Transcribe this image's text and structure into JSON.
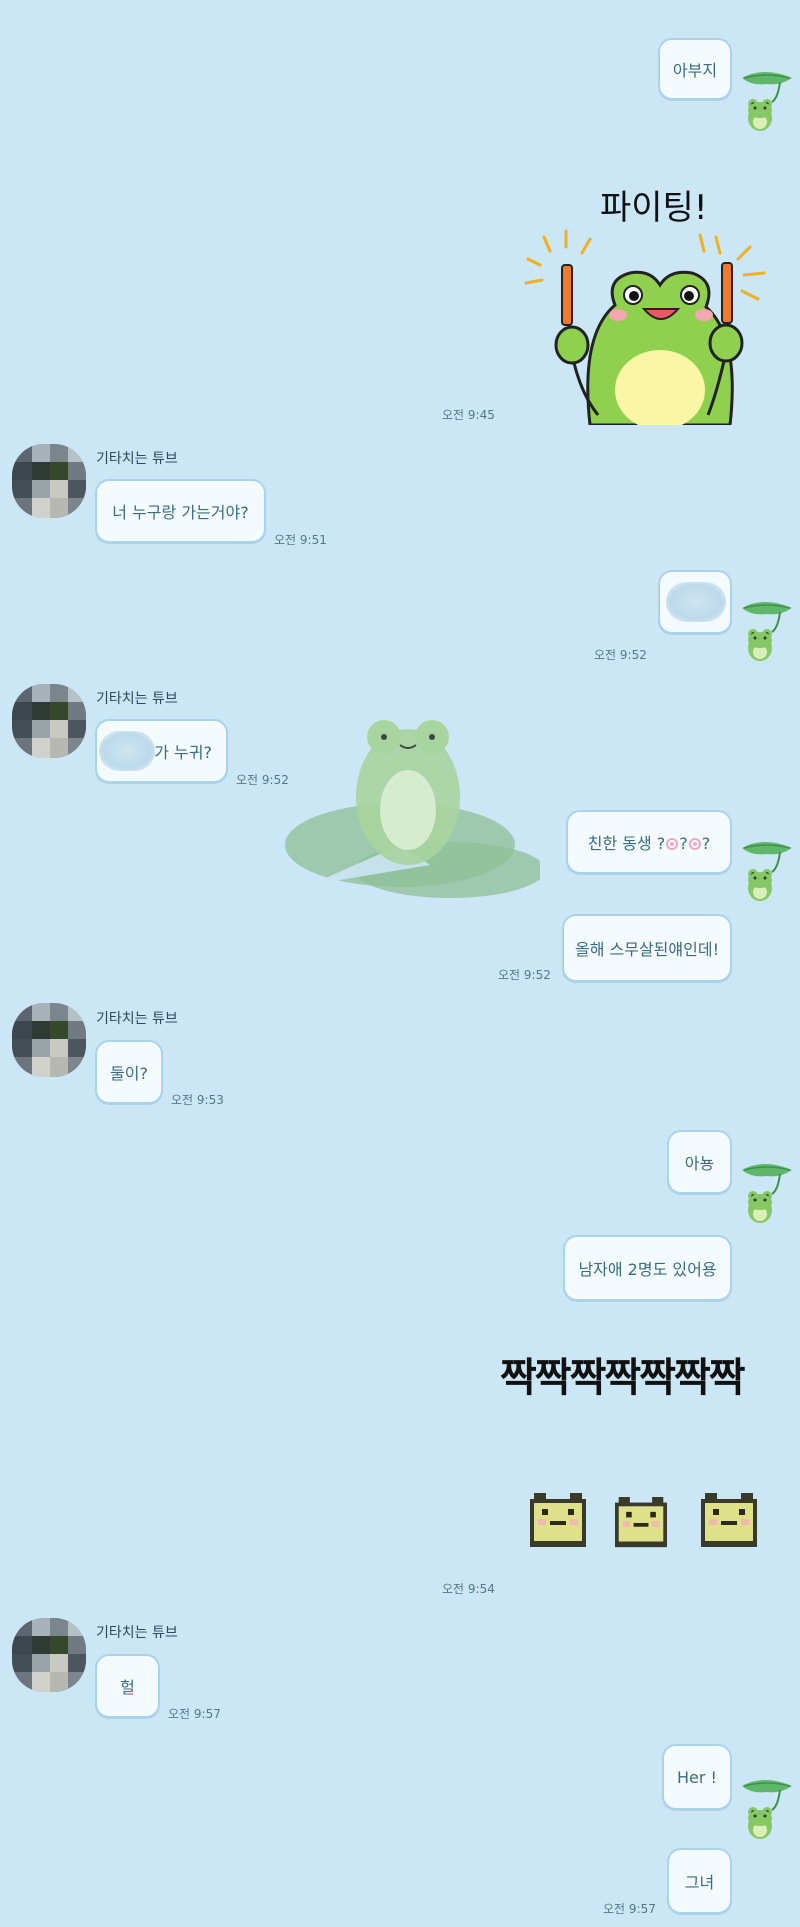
{
  "contact": {
    "name": "기타치는 튜브"
  },
  "messages": {
    "m1": "아부지",
    "sticker1_text": "파이팅!",
    "t1": "오전 9:45",
    "m2": "너 누구랑 가는거야?",
    "t2": "오전 9:51",
    "t3": "오전 9:52",
    "m3_suffix": "가 누귀?",
    "t4": "오전 9:52",
    "m4_prefix": "친한 동생 ?",
    "m4_mid": "?",
    "m4_end": "?",
    "m5": "올해 스무살된얘인데!",
    "t5": "오전 9:52",
    "m6": "둘이?",
    "t6": "오전 9:53",
    "m7": "아뇽",
    "m8": "남자애 2명도 있어용",
    "sticker2_text": "짝짝짝짝짝짝짝",
    "t7": "오전 9:54",
    "m9": "헐",
    "t8": "오전 9:57",
    "m10": "Her !",
    "m11": "그녀",
    "t9": "오전 9:57"
  },
  "colors": {
    "background": "#cbe6f5",
    "bubble": "#f3fbff",
    "bubble_border": "#a9d3e8",
    "frog_green": "#8fd14f"
  },
  "icons": [
    "frog-leaf-avatar-icon",
    "blurred-profile-avatar",
    "fighting-frog-sticker",
    "pixel-frog-sticker",
    "lilypad-frog-watermark"
  ]
}
